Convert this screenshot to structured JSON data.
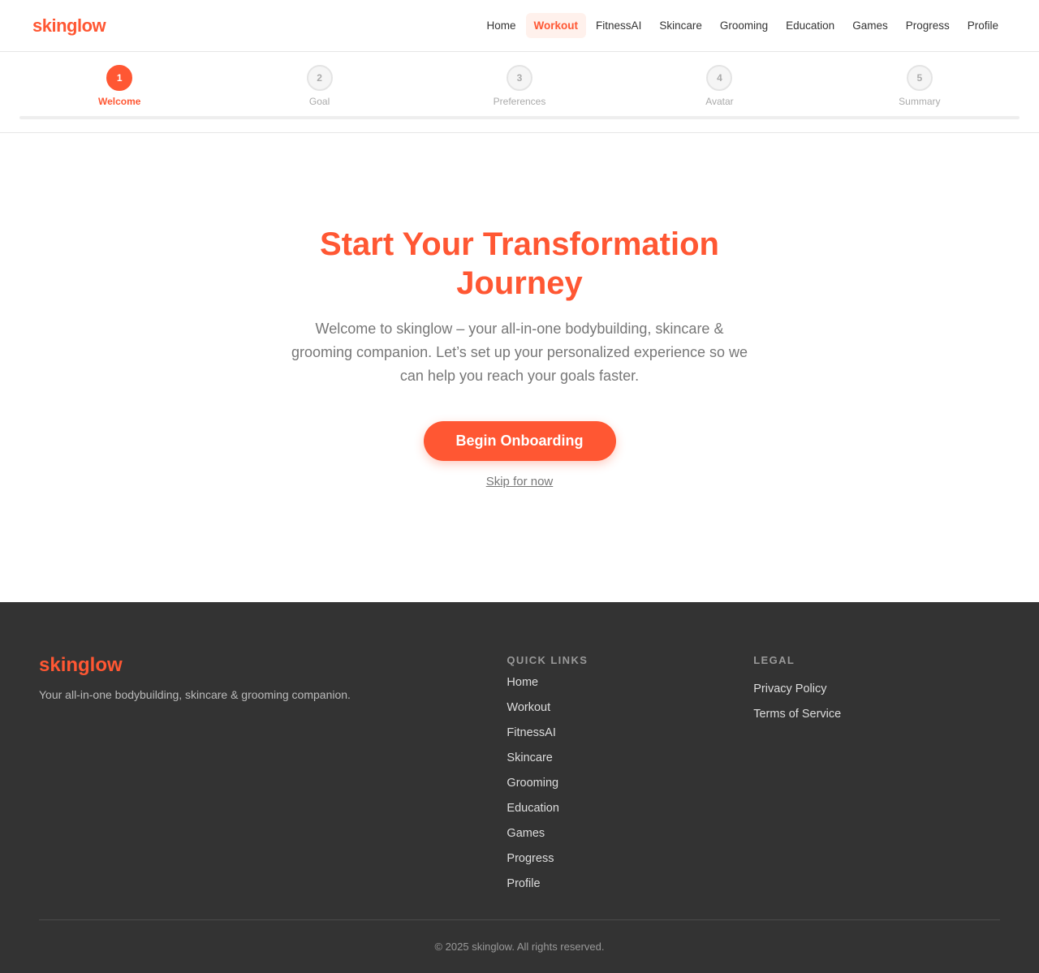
{
  "header": {
    "logo": "skinglow",
    "nav": [
      {
        "label": "Home"
      },
      {
        "label": "Workout"
      },
      {
        "label": "FitnessAI"
      },
      {
        "label": "Skincare"
      },
      {
        "label": "Grooming"
      },
      {
        "label": "Education"
      },
      {
        "label": "Games"
      },
      {
        "label": "Progress"
      },
      {
        "label": "Profile"
      }
    ],
    "active_nav": "Workout"
  },
  "stepper": {
    "steps": [
      {
        "number": "1",
        "label": "Welcome"
      },
      {
        "number": "2",
        "label": "Goal"
      },
      {
        "number": "3",
        "label": "Preferences"
      },
      {
        "number": "4",
        "label": "Avatar"
      },
      {
        "number": "5",
        "label": "Summary"
      }
    ],
    "current_step": 1,
    "progress_percent": 0
  },
  "hero": {
    "title": "Start Your Transformation Journey",
    "description": "Welcome to skinglow – your all-in-one bodybuilding, skincare & grooming companion. Let’s set up your personalized experience so we can help you reach your goals faster.",
    "cta_label": "Begin Onboarding",
    "skip_label": "Skip for now"
  },
  "footer": {
    "logo": "skinglow",
    "tagline": "Your all-in-one bodybuilding, skincare & grooming companion.",
    "quick_links_heading": "Quick Links",
    "quick_links": [
      "Home",
      "Workout",
      "FitnessAI",
      "Skincare",
      "Grooming",
      "Education",
      "Games",
      "Progress",
      "Profile"
    ],
    "legal_heading": "Legal",
    "legal_links": [
      "Privacy Policy",
      "Terms of Service"
    ],
    "copyright": "© 2025 skinglow. All rights reserved."
  },
  "colors": {
    "accent": "#ff5733",
    "footer_bg": "#333333",
    "muted_text": "#777777"
  }
}
